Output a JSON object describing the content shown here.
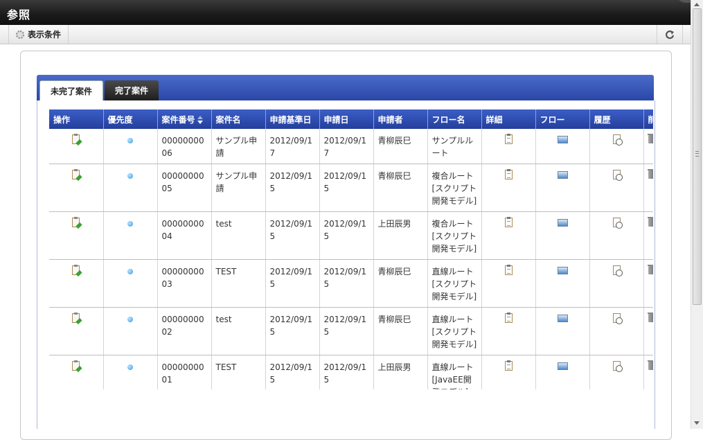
{
  "window": {
    "title": "参照"
  },
  "toolbar": {
    "condition_label": "表示条件"
  },
  "tabs": [
    {
      "label": "未完了案件",
      "active": true
    },
    {
      "label": "完了案件",
      "active": false
    }
  ],
  "table": {
    "columns": [
      "操作",
      "優先度",
      "案件番号",
      "案件名",
      "申請基準日",
      "申請日",
      "申請者",
      "フロー名",
      "詳細",
      "フロー",
      "履歴",
      "削"
    ],
    "sort_column": "案件番号",
    "rows": [
      {
        "number": "0000000006",
        "name": "サンプル申請",
        "base_date": "2012/09/17",
        "apply_date": "2012/09/17",
        "applicant": "青柳辰巳",
        "flow": "サンプルルート"
      },
      {
        "number": "0000000005",
        "name": "サンプル申請",
        "base_date": "2012/09/15",
        "apply_date": "2012/09/15",
        "applicant": "青柳辰巳",
        "flow": "複合ルート[スクリプト開発モデル]"
      },
      {
        "number": "0000000004",
        "name": "test",
        "base_date": "2012/09/15",
        "apply_date": "2012/09/15",
        "applicant": "上田辰男",
        "flow": "複合ルート[スクリプト開発モデル]"
      },
      {
        "number": "0000000003",
        "name": "TEST",
        "base_date": "2012/09/15",
        "apply_date": "2012/09/15",
        "applicant": "青柳辰巳",
        "flow": "直線ルート[スクリプト開発モデル]"
      },
      {
        "number": "0000000002",
        "name": "test",
        "base_date": "2012/09/15",
        "apply_date": "2012/09/15",
        "applicant": "青柳辰巳",
        "flow": "直線ルート[スクリプト開発モデル]"
      },
      {
        "number": "0000000001",
        "name": "TEST",
        "base_date": "2012/09/15",
        "apply_date": "2012/09/15",
        "applicant": "上田辰男",
        "flow": "直線ルート[JavaEE開発モデル]"
      }
    ]
  },
  "icons": {
    "condition": "gear-icon",
    "refresh": "refresh-icon",
    "operation": "edit-icon",
    "priority": "priority-dot-icon",
    "detail": "detail-icon",
    "flow": "flow-image-icon",
    "history": "history-icon",
    "delete": "trash-icon"
  },
  "colors": {
    "header_blue": "#2f4fb5",
    "titlebar": "#1a1a1a"
  }
}
